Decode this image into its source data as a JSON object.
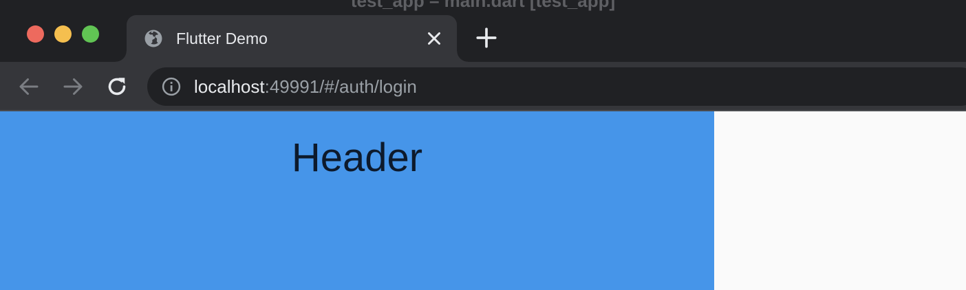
{
  "window": {
    "title": "test_app – main.dart [test_app]"
  },
  "tab": {
    "title": "Flutter Demo",
    "favicon": "globe-icon"
  },
  "toolbar": {
    "url_host": "localhost",
    "url_rest": ":49991/#/auth/login"
  },
  "page": {
    "header_text": "Header"
  },
  "colors": {
    "header_background": "#4695e9",
    "header_text": "#0d1a2c",
    "page_background": "#fafafa",
    "chrome_dark": "#202124",
    "chrome_toolbar": "#35363a"
  }
}
